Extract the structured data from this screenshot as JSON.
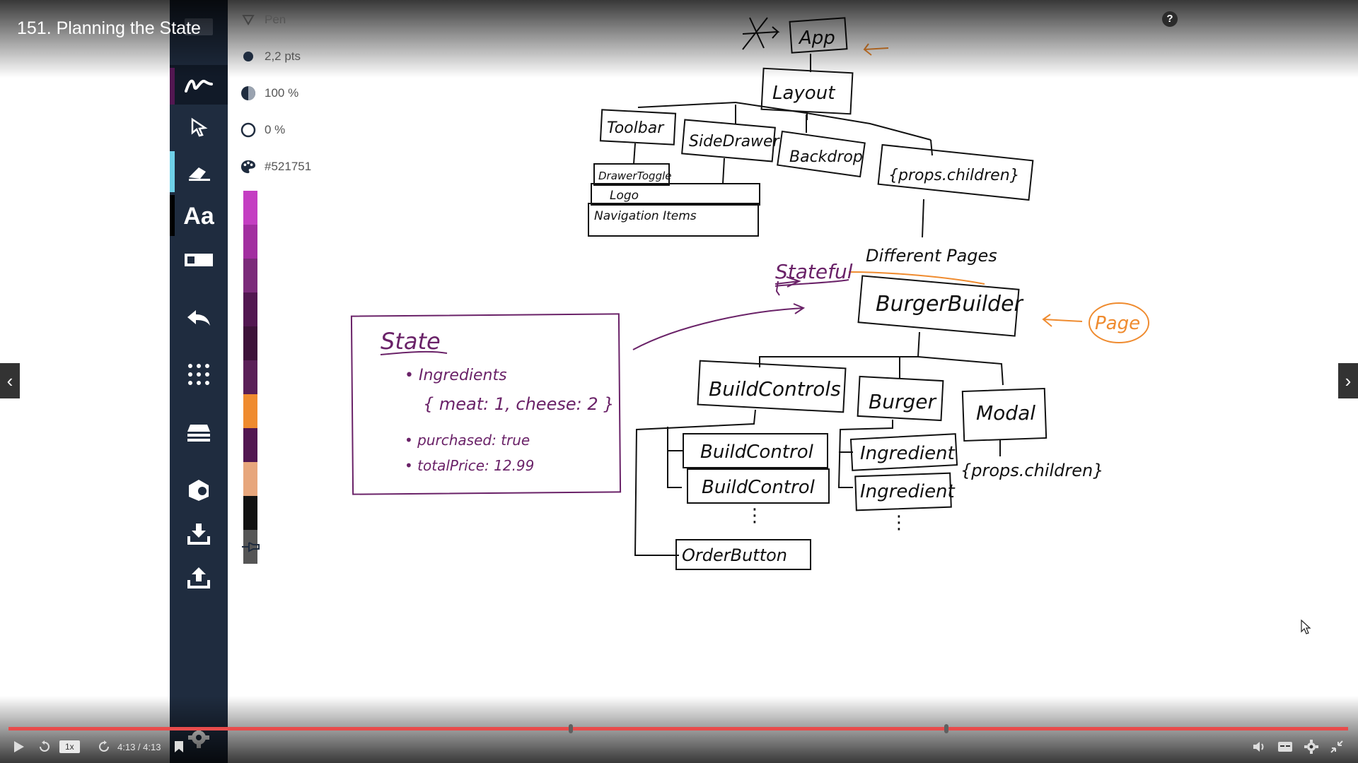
{
  "video": {
    "title": "151. Planning the State",
    "time": "4:13 / 4:13",
    "speed": "1x",
    "progress": 1.0,
    "chapter_markers": [
      0.42,
      0.7
    ]
  },
  "toolbar": {
    "tools": [
      "pen-icon",
      "pointer-icon",
      "highlighter-icon",
      "text-tool-icon",
      "shape-rect-icon",
      "undo-icon",
      "grid-icon",
      "layers-icon",
      "shapes-3d-icon",
      "download-icon",
      "upload-icon",
      "settings-icon"
    ],
    "text_tool_label": "Aa"
  },
  "pen_props": {
    "tool_name": "Pen",
    "size": "2,2 pts",
    "opacity": "100 %",
    "smoothing": "0 %",
    "color": "#521751"
  },
  "palette": [
    "#c43ec2",
    "#a22ea0",
    "#7b2a7a",
    "#521751",
    "#3d1239",
    "#5a1f57",
    "#ef8b2f",
    "#521751",
    "#e7a67c",
    "#111111",
    "#555555"
  ],
  "diagram": {
    "app": "App",
    "layout": "Layout",
    "toolbar": "Toolbar",
    "sidedrawer": "SideDrawer",
    "backdrop": "Backdrop",
    "props_children": "{props.children}",
    "drawer_toggle": "DrawerToggle",
    "logo": "Logo",
    "navigation_items": "Navigation Items",
    "different_pages": "Different Pages",
    "stateful": "Stateful",
    "burger_builder": "BurgerBuilder",
    "page": "Page",
    "build_controls": "BuildControls",
    "burger": "Burger",
    "modal": "Modal",
    "build_control_1": "BuildControl",
    "build_control_2": "BuildControl",
    "ingredient_1": "Ingredient",
    "ingredient_2": "Ingredient",
    "modal_children": "{props.children}",
    "order_button": "OrderButton",
    "dots": "⋮",
    "state_box": {
      "title": "State",
      "line1": "• Ingredients",
      "line2": "{ meat: 1, cheese: 2 }",
      "line3": "• purchased: true",
      "line4": "• totalPrice: 12.99"
    }
  }
}
